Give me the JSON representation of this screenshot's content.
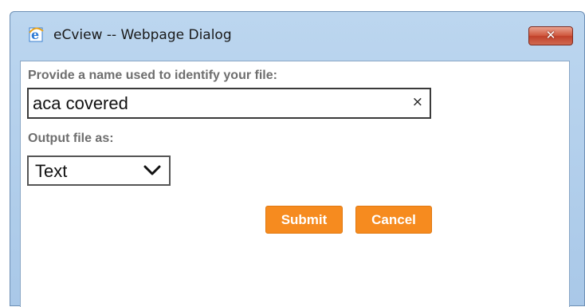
{
  "window": {
    "title": "eCview -- Webpage Dialog",
    "icon": "internet-explorer-icon",
    "close_glyph": "✕"
  },
  "form": {
    "file_name_label": "Provide a name used to identify your file:",
    "file_name_value": "aca covered",
    "clear_glyph": "×",
    "output_label": "Output file as:",
    "output_selected": "Text"
  },
  "buttons": {
    "submit_label": "Submit",
    "cancel_label": "Cancel"
  },
  "colors": {
    "accent": "#f68b1f",
    "titlebar": "#bcd6ef",
    "label_text": "#6e6e6e"
  }
}
